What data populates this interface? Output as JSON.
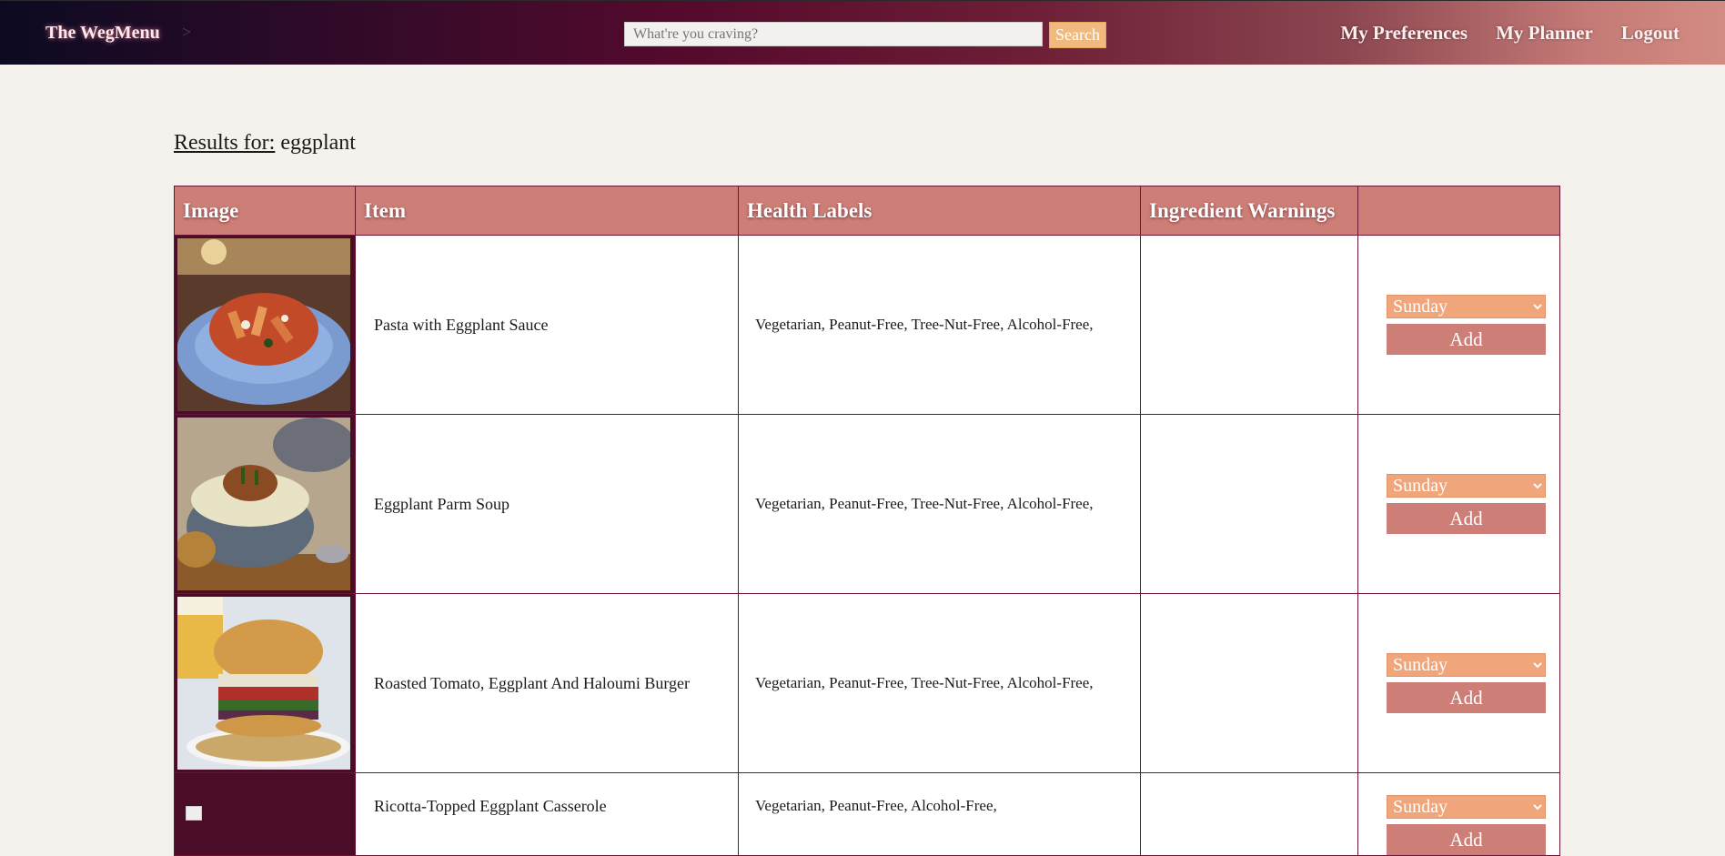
{
  "header": {
    "brand": "The WegMenu",
    "separator": ">",
    "search_placeholder": "What're you craving?",
    "search_button": "Search",
    "nav": [
      "My Preferences",
      "My Planner",
      "Logout"
    ]
  },
  "results": {
    "label": "Results for:",
    "query": "eggplant"
  },
  "table": {
    "headers": [
      "Image",
      "Item",
      "Health Labels",
      "Ingredient Warnings",
      ""
    ],
    "rows": [
      {
        "item": "Pasta with Eggplant Sauce",
        "labels": "Vegetarian, Peanut-Free, Tree-Nut-Free, Alcohol-Free,",
        "warnings": "",
        "day": "Sunday",
        "add": "Add",
        "image": "pasta-dish"
      },
      {
        "item": "Eggplant Parm Soup",
        "labels": "Vegetarian, Peanut-Free, Tree-Nut-Free, Alcohol-Free,",
        "warnings": "",
        "day": "Sunday",
        "add": "Add",
        "image": "soup-dish"
      },
      {
        "item": "Roasted Tomato, Eggplant And Haloumi Burger",
        "labels": "Vegetarian, Peanut-Free, Tree-Nut-Free, Alcohol-Free,",
        "warnings": "",
        "day": "Sunday",
        "add": "Add",
        "image": "burger-dish"
      },
      {
        "item": "Ricotta-Topped Eggplant Casserole",
        "labels": "Vegetarian, Peanut-Free, Alcohol-Free,",
        "warnings": "",
        "day": "Sunday",
        "add": "Add",
        "image": "broken"
      }
    ]
  },
  "colors": {
    "header_bg": "#cd7f77",
    "select_bg": "#f0a67a",
    "search_button_bg": "#f0b97f",
    "border": "#6b1533"
  }
}
